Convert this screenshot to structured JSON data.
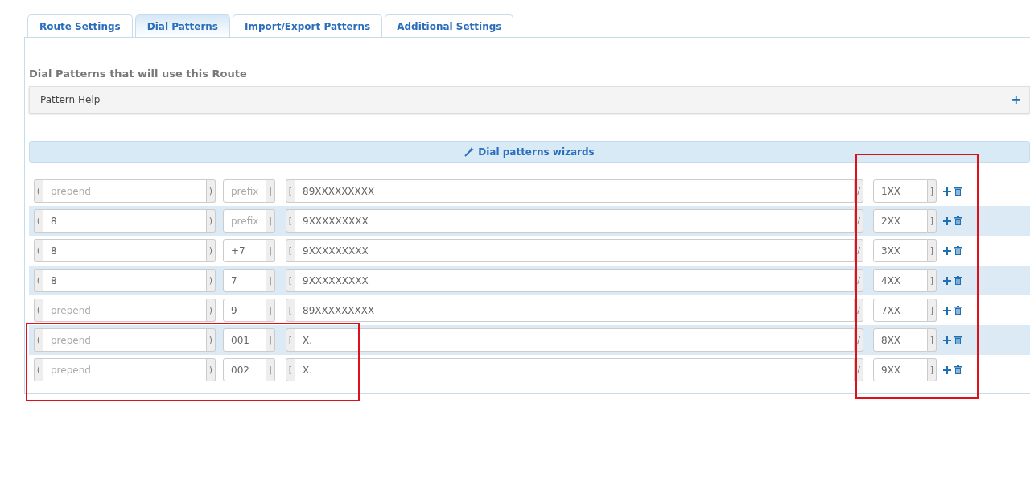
{
  "tabs": [
    {
      "label": "Route Settings",
      "selected": false
    },
    {
      "label": "Dial Patterns",
      "selected": true
    },
    {
      "label": "Import/Export Patterns",
      "selected": false
    },
    {
      "label": "Additional Settings",
      "selected": false
    }
  ],
  "section_title": "Dial Patterns that will use this Route",
  "pattern_help": {
    "label": "Pattern Help",
    "expand_symbol": "+"
  },
  "wizard_button": {
    "label": "Dial patterns wizards"
  },
  "rows": [
    {
      "brackets": [
        "(",
        ")",
        "|",
        "[",
        "/",
        "]"
      ],
      "prepend": {
        "placeholder": "prepend"
      },
      "prefix": {
        "placeholder": "prefix"
      },
      "match_pattern": {
        "value": "89XXXXXXXXX"
      },
      "caller_id": {
        "value": "1XX"
      },
      "boxed": false
    },
    {
      "brackets": [
        "(",
        ")",
        "|",
        "[",
        "/",
        "]"
      ],
      "prepend": {
        "value": "8"
      },
      "prefix": {
        "placeholder": "prefix"
      },
      "match_pattern": {
        "value": "9XXXXXXXXX"
      },
      "caller_id": {
        "value": "2XX"
      },
      "boxed": false
    },
    {
      "brackets": [
        "(",
        ")",
        "|",
        "[",
        "/",
        "]"
      ],
      "prepend": {
        "value": "8"
      },
      "prefix": {
        "value": "+7"
      },
      "match_pattern": {
        "value": "9XXXXXXXXX"
      },
      "caller_id": {
        "value": "3XX"
      },
      "boxed": false
    },
    {
      "brackets": [
        "(",
        ")",
        "|",
        "[",
        "/",
        "]"
      ],
      "prepend": {
        "value": "8"
      },
      "prefix": {
        "value": "7"
      },
      "match_pattern": {
        "value": "9XXXXXXXXX"
      },
      "caller_id": {
        "value": "4XX"
      },
      "boxed": false
    },
    {
      "brackets": [
        "(",
        ")",
        "|",
        "[",
        "/",
        "]"
      ],
      "prepend": {
        "placeholder": "prepend"
      },
      "prefix": {
        "value": "9"
      },
      "match_pattern": {
        "value": "89XXXXXXXXX"
      },
      "caller_id": {
        "value": "7XX"
      },
      "boxed": false
    },
    {
      "brackets": [
        "(",
        ")",
        "|",
        "[",
        "/",
        "]"
      ],
      "prepend": {
        "placeholder": "prepend"
      },
      "prefix": {
        "value": "001"
      },
      "match_pattern": {
        "value": "X."
      },
      "caller_id": {
        "value": "8XX"
      },
      "boxed": true
    },
    {
      "brackets": [
        "(",
        ")",
        "|",
        "[",
        "/",
        "]"
      ],
      "prepend": {
        "placeholder": "prepend"
      },
      "prefix": {
        "value": "002"
      },
      "match_pattern": {
        "value": "X."
      },
      "caller_id": {
        "value": "9XX"
      },
      "boxed": true
    }
  ],
  "caller_id_column_boxed": true
}
